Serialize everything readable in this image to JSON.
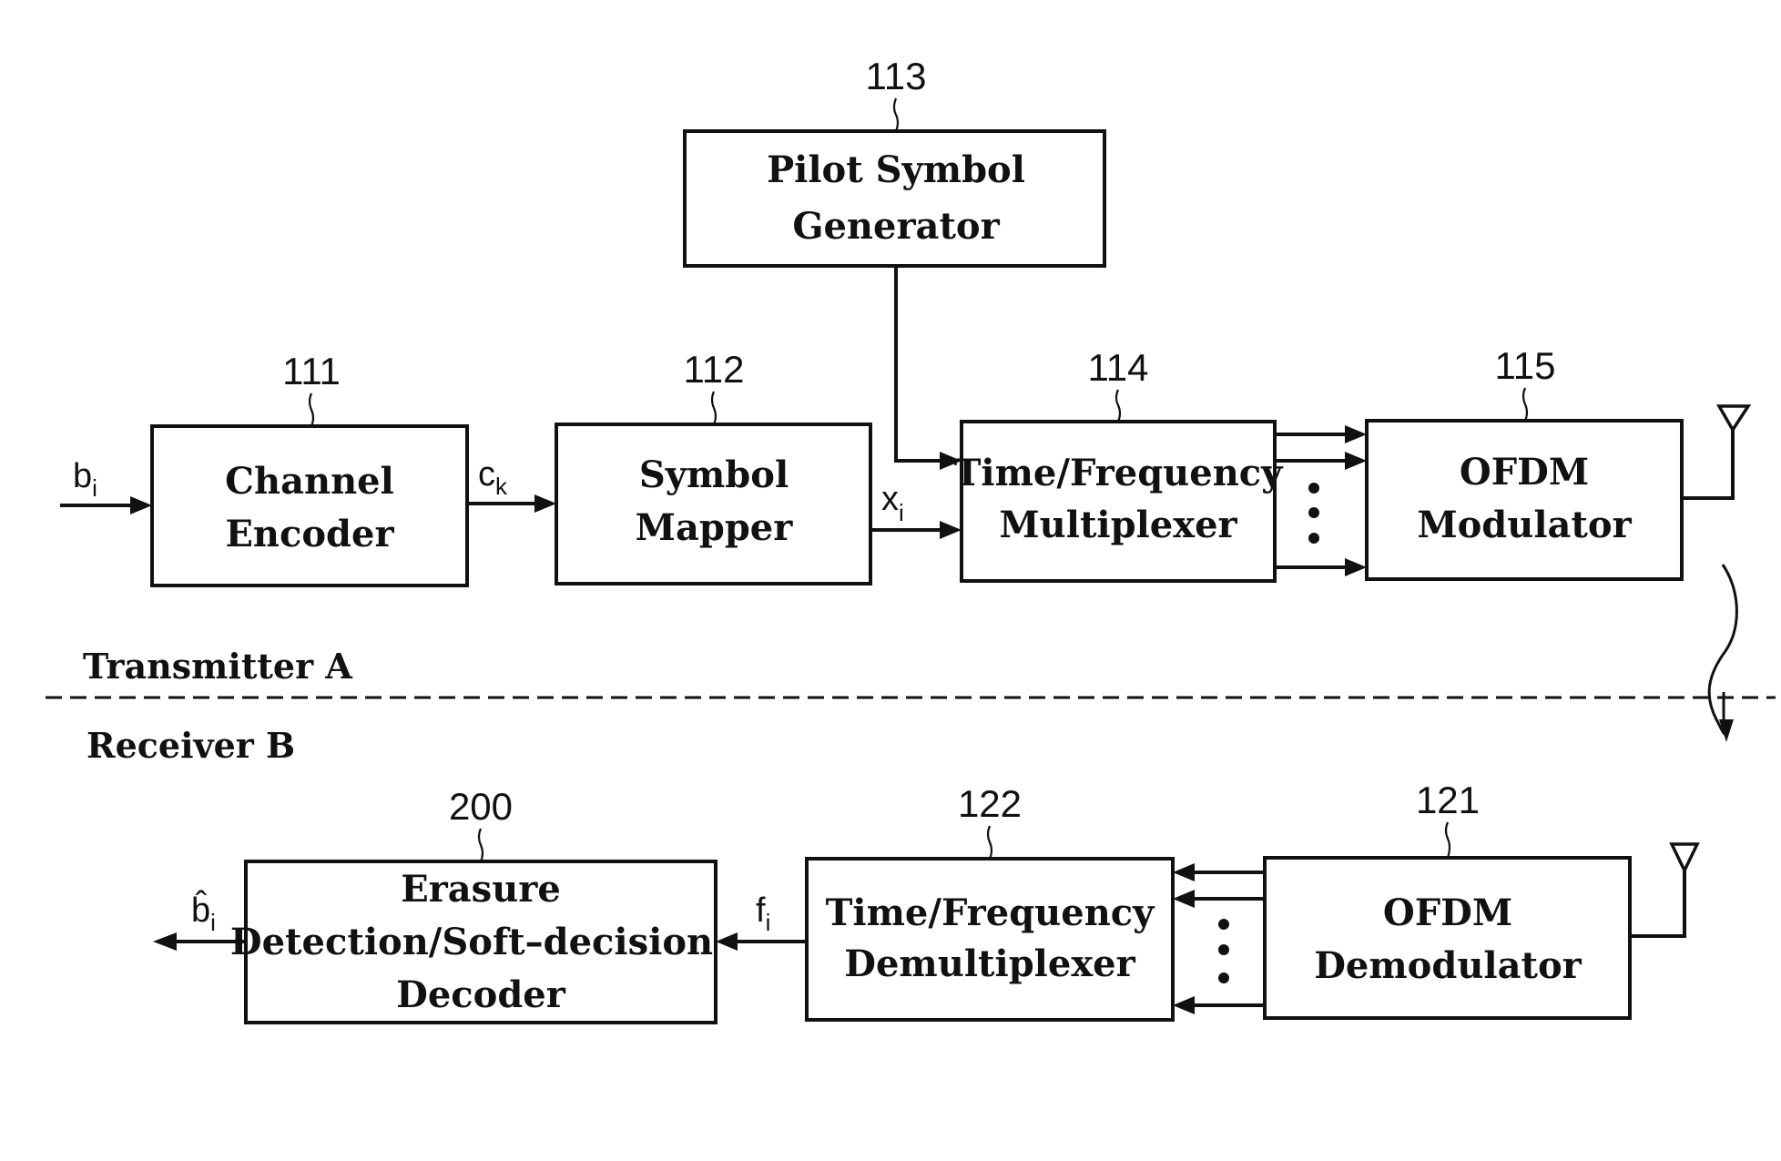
{
  "diagram": {
    "sections": {
      "transmitter": "Transmitter  A",
      "receiver": "Receiver  B"
    },
    "blocks": {
      "pilot": {
        "ref": "113",
        "lines": [
          "Pilot  Symbol",
          "Generator"
        ]
      },
      "encoder": {
        "ref": "111",
        "lines": [
          "Channel",
          "Encoder"
        ]
      },
      "mapper": {
        "ref": "112",
        "lines": [
          "Symbol",
          "Mapper"
        ]
      },
      "mux": {
        "ref": "114",
        "lines": [
          "Time/Frequency",
          "Multiplexer"
        ]
      },
      "modulator": {
        "ref": "115",
        "lines": [
          "OFDM",
          "Modulator"
        ]
      },
      "decoder": {
        "ref": "200",
        "lines": [
          "Erasure",
          "Detection/Soft–decision",
          "Decoder"
        ]
      },
      "demux": {
        "ref": "122",
        "lines": [
          "Time/Frequency",
          "Demultiplexer"
        ]
      },
      "demodulator": {
        "ref": "121",
        "lines": [
          "OFDM",
          "Demodulator"
        ]
      }
    },
    "signals": {
      "input": {
        "base": "b",
        "sub": "i"
      },
      "coded": {
        "base": "c",
        "sub": "k"
      },
      "symbols": {
        "base": "x",
        "sub": "i"
      },
      "demuxed": {
        "base": "f",
        "sub": "i"
      },
      "output": {
        "base": "b̂",
        "sub": "i"
      }
    }
  }
}
